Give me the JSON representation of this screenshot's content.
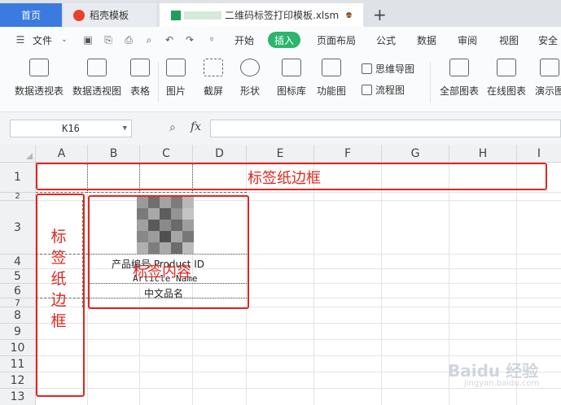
{
  "tabs": {
    "home": "首页",
    "daoke": "稻壳模板",
    "file": "二维码标签打印模板.xlsm",
    "new_tab": "+"
  },
  "menu": {
    "file": "文件",
    "items": [
      "开始",
      "插入",
      "页面布局",
      "公式",
      "数据",
      "审阅",
      "视图",
      "安全"
    ],
    "active": "插入"
  },
  "ribbon": {
    "pivot_table": "数据透视表",
    "pivot_chart": "数据透视图",
    "table": "表格",
    "picture": "图片",
    "screenshot": "截屏",
    "shape": "形状",
    "icon_lib": "图标库",
    "function_chart": "功能图",
    "mind_map": "思维导图",
    "flow_chart": "流程图",
    "all_charts": "全部图表",
    "online_chart": "在线图表",
    "demo_chart": "演示图"
  },
  "formula_bar": {
    "cell_ref": "K16",
    "fx": "fx",
    "formula": ""
  },
  "sheet": {
    "columns": [
      "A",
      "B",
      "C",
      "D",
      "E",
      "F",
      "G",
      "H",
      "I"
    ],
    "rows": [
      "1",
      "2",
      "3",
      "4",
      "5",
      "6",
      "7",
      "8",
      "9",
      "10",
      "11",
      "12",
      "13"
    ],
    "label_fields": {
      "product_code": "产品编号 Product ID",
      "article_name": "Article Name",
      "chinese_name": "中文品名"
    }
  },
  "annotations": {
    "label_paper_border": "标签纸边框",
    "label_paper_border_vertical": [
      "标",
      "签",
      "纸",
      "边",
      "框"
    ],
    "label_content": "标签内容"
  },
  "watermark": {
    "brand": "Baidu 经验",
    "url": "jingyan.baidu.com"
  },
  "colors": {
    "accent_blue": "#3b7be0",
    "insert_green": "#2cb56c",
    "annotation_red": "#e0271f"
  }
}
